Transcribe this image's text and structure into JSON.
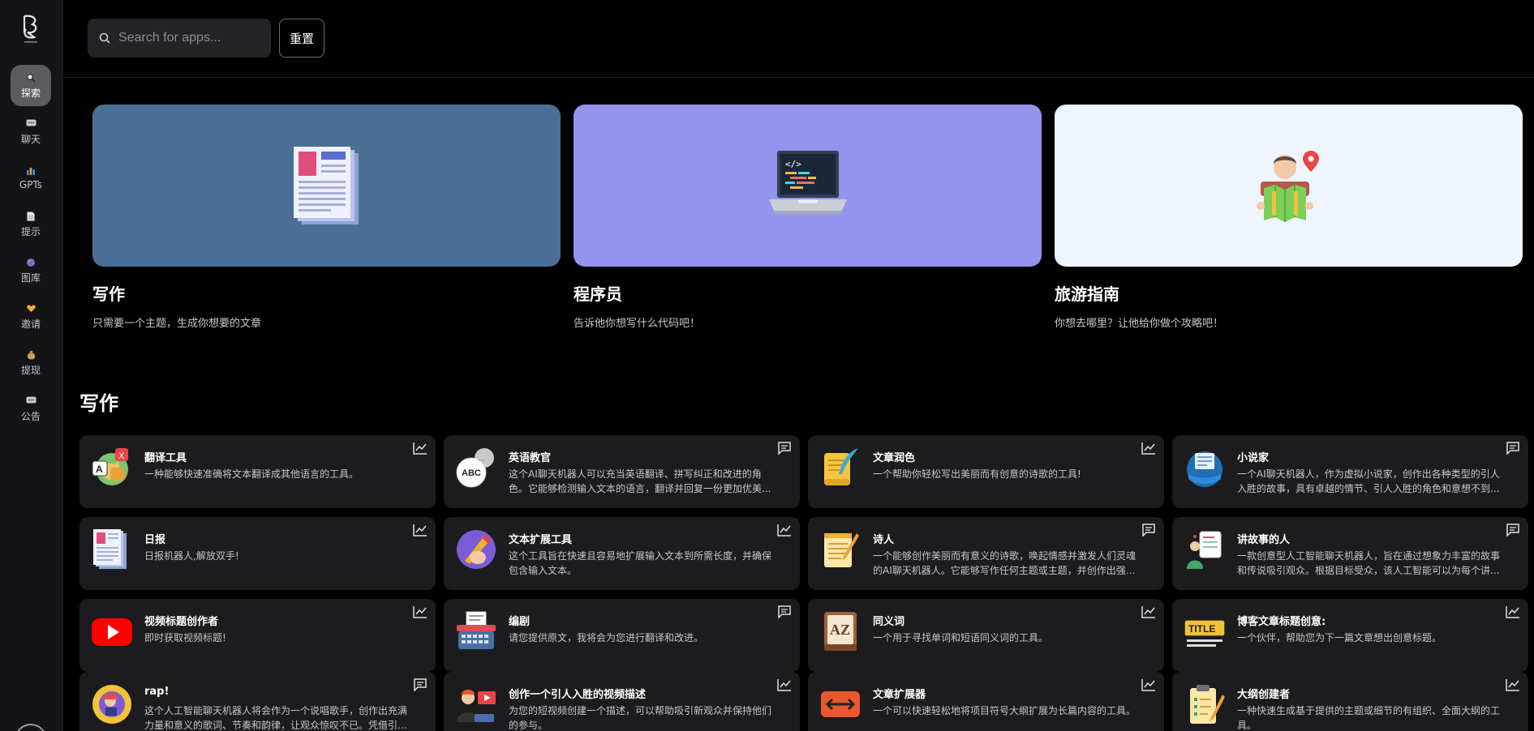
{
  "sidebar": {
    "logo_icon": "brain-logo-icon",
    "items": [
      {
        "label": "探索",
        "icon": "magnifier-icon",
        "active": true
      },
      {
        "label": "聊天",
        "icon": "chat-bubble-icon"
      },
      {
        "label": "GPTs",
        "icon": "bar-chart-icon"
      },
      {
        "label": "提示",
        "icon": "document-icon"
      },
      {
        "label": "图库",
        "icon": "palette-icon"
      },
      {
        "label": "邀请",
        "icon": "heart-hands-icon"
      },
      {
        "label": "提现",
        "icon": "money-bag-icon"
      },
      {
        "label": "公告",
        "icon": "chat-bubble-icon"
      }
    ]
  },
  "topbar": {
    "search_placeholder": "Search for apps...",
    "search_value": "",
    "reset_label": "重置"
  },
  "featured": [
    {
      "title": "写作",
      "desc": "只需要一个主题，生成你想要的文章",
      "bg": "#4a6f94",
      "icon": "newspaper-icon"
    },
    {
      "title": "程序员",
      "desc": "告诉他你想写什么代码吧！",
      "bg": "#9494ee",
      "icon": "laptop-code-icon"
    },
    {
      "title": "旅游指南",
      "desc": "你想去哪里？让他给你做个攻略吧！",
      "bg": "#eef5fc",
      "icon": "traveler-icon"
    }
  ],
  "section": {
    "title": "写作",
    "apps": [
      {
        "name": "翻译工具",
        "desc": "一种能够快速准确将文本翻译成其他语言的工具。",
        "icon": "translate-icon",
        "corner": "trend-icon"
      },
      {
        "name": "英语教官",
        "desc": "这个AI聊天机器人可以充当英语翻译、拼写纠正和改进的角色。它能够检测输入文本的语言，翻译并回复一份更加优美...",
        "icon": "abc-speech-icon",
        "corner": "chat-icon"
      },
      {
        "name": "文章润色",
        "desc": "一个帮助你轻松写出美丽而有创意的诗歌的工具!",
        "icon": "quill-scroll-icon",
        "corner": "trend-icon"
      },
      {
        "name": "小说家",
        "desc": "一个AI聊天机器人，作为虚拟小说家，创作出各种类型的引人入胜的故事，具有卓越的情节、引人入胜的角色和意想不到...",
        "icon": "novel-globe-icon",
        "corner": "chat-icon"
      },
      {
        "name": "日报",
        "desc": "日报机器人,解放双手!",
        "icon": "newspaper-icon",
        "corner": "trend-icon"
      },
      {
        "name": "文本扩展工具",
        "desc": "这个工具旨在快速且容易地扩展输入文本到所需长度，并确保包含输入文本。",
        "icon": "pencil-hand-icon",
        "corner": "trend-icon"
      },
      {
        "name": "诗人",
        "desc": "一个能够创作美丽而有意义的诗歌，唤起情感并激发人们灵魂的AI聊天机器人。它能够写作任何主题或主题，并创作出强大...",
        "icon": "notepad-pen-icon",
        "corner": "chat-icon"
      },
      {
        "name": "讲故事的人",
        "desc": "一款创意型人工智能聊天机器人，旨在通过想象力丰富的故事和传说吸引观众。根据目标受众，该人工智能可以为每个讲...",
        "icon": "storyteller-icon",
        "corner": "chat-icon"
      },
      {
        "name": "视频标题创作者",
        "desc": "即时获取视频标题!",
        "icon": "youtube-icon",
        "corner": "trend-icon"
      },
      {
        "name": "编剧",
        "desc": "请您提供原文，我将会为您进行翻译和改进。",
        "icon": "typewriter-icon",
        "corner": "chat-icon"
      },
      {
        "name": "同义词",
        "desc": "一个用于寻找单词和短语同义词的工具。",
        "icon": "dictionary-icon",
        "corner": "trend-icon"
      },
      {
        "name": "博客文章标题创意:",
        "desc": "一个伙伴，帮助您为下一篇文章想出创意标题。",
        "icon": "title-sign-icon",
        "corner": "trend-icon"
      },
      {
        "name": "rap!",
        "desc": "这个人工智能聊天机器人将会作为一个说唱歌手，创作出充满力量和意义的歌词、节奏和韵律，让观众惊叹不已。凭借引...",
        "icon": "rapper-icon",
        "corner": "chat-icon"
      },
      {
        "name": "创作一个引人入胜的视频描述",
        "desc": "为您的短视频创建一个描述，可以帮助吸引新观众并保持他们的参与。",
        "icon": "video-creator-icon",
        "corner": "trend-icon"
      },
      {
        "name": "文章扩展器",
        "desc": "一个可以快速轻松地将项目符号大纲扩展为长篇内容的工具。",
        "icon": "expand-arrows-icon",
        "corner": "trend-icon"
      },
      {
        "name": "大纲创建者",
        "desc": "一种快速生成基于提供的主题或细节的有组织、全面大纲的工具。",
        "icon": "clipboard-pencil-icon",
        "corner": "trend-icon"
      }
    ]
  }
}
